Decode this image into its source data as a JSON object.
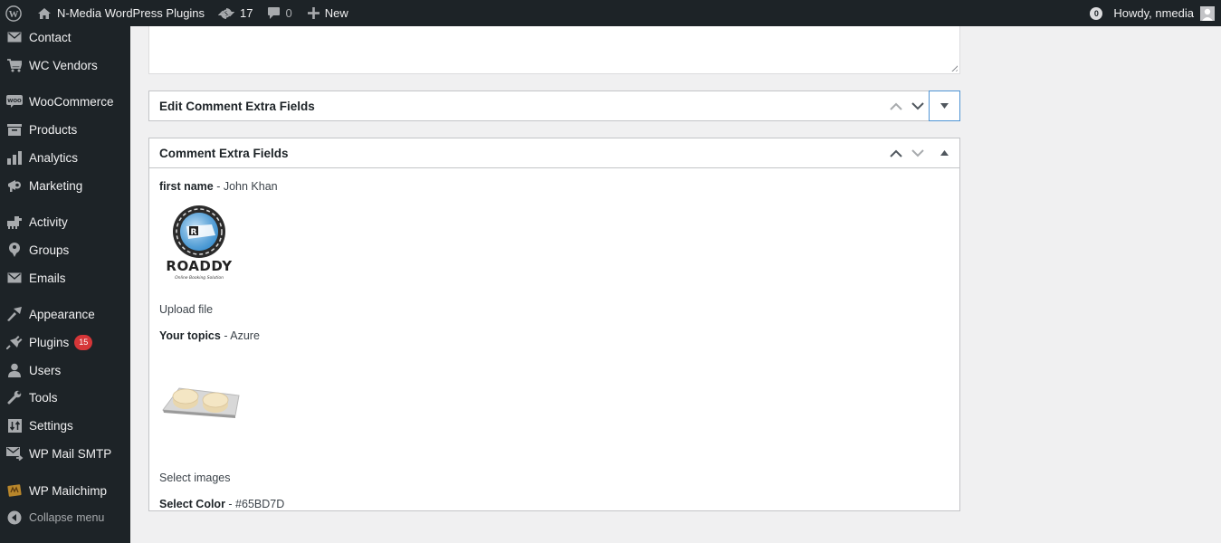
{
  "adminbar": {
    "wp_logo": "wordpress-logo-icon",
    "site_name": "N-Media WordPress Plugins",
    "updates_count": "17",
    "comments_count": "0",
    "new_label": "New",
    "notifications_count": "0",
    "howdy": "Howdy, nmedia"
  },
  "sidebar": {
    "items": [
      {
        "label": "Contact",
        "icon": "envelope-icon"
      },
      {
        "label": "WC Vendors",
        "icon": "cart-icon"
      },
      {
        "label": "WooCommerce",
        "icon": "woo-icon"
      },
      {
        "label": "Products",
        "icon": "archive-icon"
      },
      {
        "label": "Analytics",
        "icon": "bar-chart-icon"
      },
      {
        "label": "Marketing",
        "icon": "megaphone-icon"
      },
      {
        "label": "Activity",
        "icon": "activity-icon"
      },
      {
        "label": "Groups",
        "icon": "groups-icon"
      },
      {
        "label": "Emails",
        "icon": "envelope-icon"
      },
      {
        "label": "Appearance",
        "icon": "paintbrush-icon"
      },
      {
        "label": "Plugins",
        "icon": "plug-icon",
        "badge": "15"
      },
      {
        "label": "Users",
        "icon": "user-icon"
      },
      {
        "label": "Tools",
        "icon": "wrench-icon"
      },
      {
        "label": "Settings",
        "icon": "settings-icon"
      },
      {
        "label": "WP Mail SMTP",
        "icon": "mail-smtp-icon"
      },
      {
        "label": "WP Mailchimp",
        "icon": "mailchimp-icon"
      },
      {
        "label": "Collapse menu",
        "icon": "collapse-icon"
      }
    ]
  },
  "metaboxes": {
    "edit": {
      "title": "Edit Comment Extra Fields"
    },
    "view": {
      "title": "Comment Extra Fields",
      "fields": {
        "first_name_label": "first name",
        "first_name_value": " - John Khan",
        "image1_alt": "ROADDY",
        "image1_sub": "Online Booking Solution",
        "upload_caption": "Upload file",
        "topics_label": "Your topics",
        "topics_value": " - Azure",
        "select_images_caption": "Select images",
        "color_label": "Select Color",
        "color_value": " - #65BD7D"
      }
    }
  },
  "colors": {
    "adminbar_bg": "#1d2327",
    "badge_red": "#d63638",
    "focus_blue": "#4f94d4"
  }
}
